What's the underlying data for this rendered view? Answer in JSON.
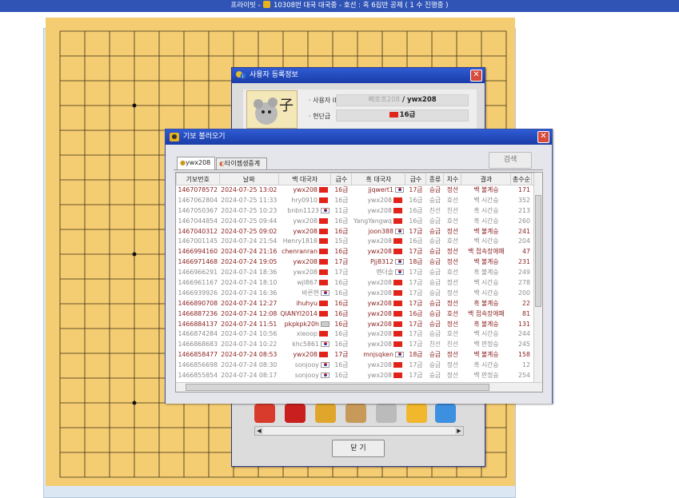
{
  "window_title": {
    "prefix": "프라이빗 - ",
    "middle": " 10308번 대국",
    "rest": "    대국중 - 호선 : 흑 6집반 공제 ( 1 수 진행중 )"
  },
  "user_window": {
    "title": "사용자 등록정보",
    "id_label": "사용자 ID",
    "id_value_prefix": "빼호호208",
    "id_value": " / ywx208",
    "rank_label": "현단급",
    "rank_value": "16급",
    "close_button": "닫 기"
  },
  "record_window": {
    "title": "기보 불러오기",
    "search_button": "검색",
    "tabs": [
      "ywx208",
      "타이젬생중계"
    ],
    "columns": [
      "기보번호",
      "날짜",
      "백 대국자",
      "급수",
      "흑 대국자",
      "급수",
      "종류",
      "치수",
      "결과",
      "총수순",
      "대"
    ],
    "rows": [
      {
        "id": "1467078572",
        "date": "2024-07-25 13:02",
        "white": "ywx208",
        "wf": "cn",
        "wr": "16급",
        "black": "jjqwert1",
        "bf": "kr",
        "br": "17급",
        "type": "승급",
        "hc": "정선",
        "res": "백 불계승",
        "moves": "171",
        "hl": true
      },
      {
        "id": "1467062804",
        "date": "2024-07-25 11:33",
        "white": "hry0910",
        "wf": "cn",
        "wr": "16급",
        "black": "ywx208",
        "bf": "cn",
        "br": "16급",
        "type": "승급",
        "hc": "호선",
        "res": "백 시간승",
        "moves": "352",
        "hl": false
      },
      {
        "id": "1467050367",
        "date": "2024-07-25 10:23",
        "white": "bnbn1123",
        "wf": "kr",
        "wr": "11급",
        "black": "ywx208",
        "bf": "cn",
        "br": "16급",
        "type": "친선",
        "hc": "친선",
        "res": "흑 시간승",
        "moves": "213",
        "hl": false
      },
      {
        "id": "1467044854",
        "date": "2024-07-25 09:44",
        "white": "ywx208",
        "wf": "cn",
        "wr": "16급",
        "black": "YangYangwq",
        "bf": "cn",
        "br": "16급",
        "type": "승급",
        "hc": "호선",
        "res": "흑 시간승",
        "moves": "260",
        "hl": false
      },
      {
        "id": "1467040312",
        "date": "2024-07-25 09:02",
        "white": "ywx208",
        "wf": "cn",
        "wr": "16급",
        "black": "joon388",
        "bf": "kr",
        "br": "17급",
        "type": "승급",
        "hc": "정선",
        "res": "백 불계승",
        "moves": "241",
        "hl": true
      },
      {
        "id": "1467001145",
        "date": "2024-07-24 21:54",
        "white": "Henry1818",
        "wf": "cn",
        "wr": "15급",
        "black": "ywx208",
        "bf": "cn",
        "br": "16급",
        "type": "승급",
        "hc": "호선",
        "res": "백 시간승",
        "moves": "204",
        "hl": false
      },
      {
        "id": "1466994160",
        "date": "2024-07-24 21:16",
        "white": "chenranran",
        "wf": "cn",
        "wr": "16급",
        "black": "ywx208",
        "bf": "cn",
        "br": "17급",
        "type": "승급",
        "hc": "정선",
        "res": "백 접속장애패",
        "moves": "47",
        "hl": true
      },
      {
        "id": "1466971468",
        "date": "2024-07-24 19:05",
        "white": "ywx208",
        "wf": "cn",
        "wr": "17급",
        "black": "Pjj8312",
        "bf": "kr",
        "br": "18급",
        "type": "승급",
        "hc": "정선",
        "res": "백 불계승",
        "moves": "231",
        "hl": true
      },
      {
        "id": "1466966291",
        "date": "2024-07-24 18:36",
        "white": "ywx208",
        "wf": "cn",
        "wr": "17급",
        "black": "펜더솔",
        "bf": "kr",
        "br": "17급",
        "type": "승급",
        "hc": "호선",
        "res": "흑 불계승",
        "moves": "249",
        "hl": false
      },
      {
        "id": "1466961167",
        "date": "2024-07-24 18:10",
        "white": "wjl867",
        "wf": "cn",
        "wr": "16급",
        "black": "ywx208",
        "bf": "cn",
        "br": "17급",
        "type": "승급",
        "hc": "정선",
        "res": "백 시간승",
        "moves": "278",
        "hl": false
      },
      {
        "id": "1466939926",
        "date": "2024-07-24 16:36",
        "white": "바른현",
        "wf": "kr",
        "wr": "16급",
        "black": "ywx208",
        "bf": "cn",
        "br": "17급",
        "type": "승급",
        "hc": "정선",
        "res": "백 시간승",
        "moves": "200",
        "hl": false
      },
      {
        "id": "1466890708",
        "date": "2024-07-24 12:27",
        "white": "ihuhyu",
        "wf": "cn",
        "wr": "16급",
        "black": "ywx208",
        "bf": "cn",
        "br": "17급",
        "type": "승급",
        "hc": "정선",
        "res": "흑 불계승",
        "moves": "22",
        "hl": true
      },
      {
        "id": "1466887236",
        "date": "2024-07-24 12:08",
        "white": "QIANYI2014",
        "wf": "cn",
        "wr": "16급",
        "black": "ywx208",
        "bf": "cn",
        "br": "16급",
        "type": "승급",
        "hc": "호선",
        "res": "백 접속장애패",
        "moves": "81",
        "hl": true
      },
      {
        "id": "1466884137",
        "date": "2024-07-24 11:51",
        "white": "pkpkpk20h",
        "wf": "un",
        "wr": "16급",
        "black": "ywx208",
        "bf": "cn",
        "br": "17급",
        "type": "승급",
        "hc": "정선",
        "res": "흑 불계승",
        "moves": "131",
        "hl": true
      },
      {
        "id": "1466874284",
        "date": "2024-07-24 10:56",
        "white": "xieoop",
        "wf": "cn",
        "wr": "16급",
        "black": "ywx208",
        "bf": "cn",
        "br": "17급",
        "type": "승급",
        "hc": "호선",
        "res": "백 시간승",
        "moves": "244",
        "hl": false
      },
      {
        "id": "1466868683",
        "date": "2024-07-24 10:22",
        "white": "khc5861",
        "wf": "kr",
        "wr": "16급",
        "black": "ywx208",
        "bf": "cn",
        "br": "17급",
        "type": "친선",
        "hc": "친선",
        "res": "백 판정승",
        "moves": "245",
        "hl": false
      },
      {
        "id": "1466858477",
        "date": "2024-07-24 08:53",
        "white": "ywx208",
        "wf": "cn",
        "wr": "17급",
        "black": "mnjsqken",
        "bf": "kr",
        "br": "18급",
        "type": "승급",
        "hc": "정선",
        "res": "백 불계승",
        "moves": "158",
        "hl": true
      },
      {
        "id": "1466856698",
        "date": "2024-07-24 08:30",
        "white": "sonjooy",
        "wf": "kr",
        "wr": "16급",
        "black": "ywx208",
        "bf": "cn",
        "br": "17급",
        "type": "승급",
        "hc": "정선",
        "res": "흑 시간승",
        "moves": "12",
        "hl": false
      },
      {
        "id": "1466855854",
        "date": "2024-07-24 08:17",
        "white": "sonjooy",
        "wf": "kr",
        "wr": "16급",
        "black": "ywx208",
        "bf": "cn",
        "br": "17급",
        "type": "승급",
        "hc": "정선",
        "res": "백 판정승",
        "moves": "254",
        "hl": false
      }
    ]
  }
}
